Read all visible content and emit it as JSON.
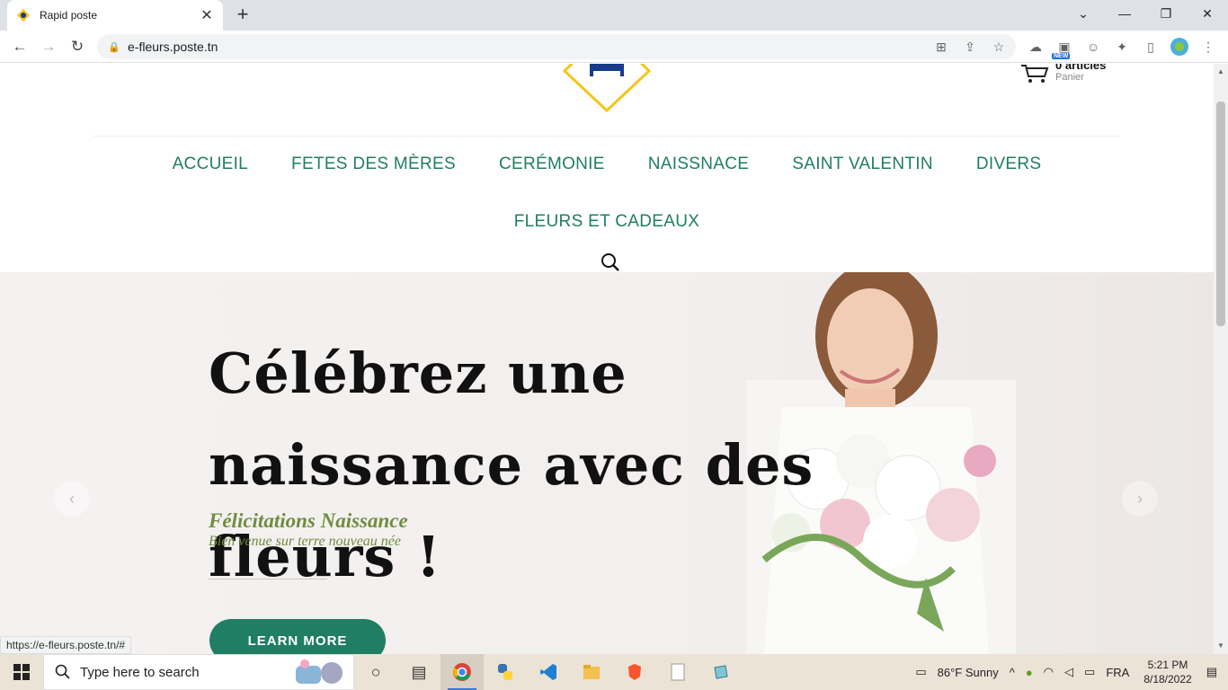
{
  "browser": {
    "tab_title": "Rapid poste",
    "url": "e-fleurs.poste.tn",
    "status_url": "https://e-fleurs.poste.tn/#",
    "ext_badge": "NEW"
  },
  "header": {
    "cart_count": "0 articles",
    "cart_label": "Panier"
  },
  "nav": {
    "items": [
      "ACCUEIL",
      "FETES DES MÈRES",
      "CERÉMONIE",
      "NAISSNACE",
      "SAINT VALENTIN",
      "DIVERS"
    ],
    "row2": "FLEURS ET CADEAUX"
  },
  "hero": {
    "title": "Célébrez une naissance avec des fleurs !",
    "subtitle": "Félicitations Naissance",
    "tagline": "Bien venue sur terre nouveau née",
    "button": "LEARN MORE"
  },
  "taskbar": {
    "search_placeholder": "Type here to search",
    "weather": "86°F  Sunny",
    "language": "FRA",
    "time": "5:21 PM",
    "date": "8/18/2022"
  },
  "colors": {
    "accent": "#1f7e63",
    "subtitle": "#6f8d3e"
  }
}
